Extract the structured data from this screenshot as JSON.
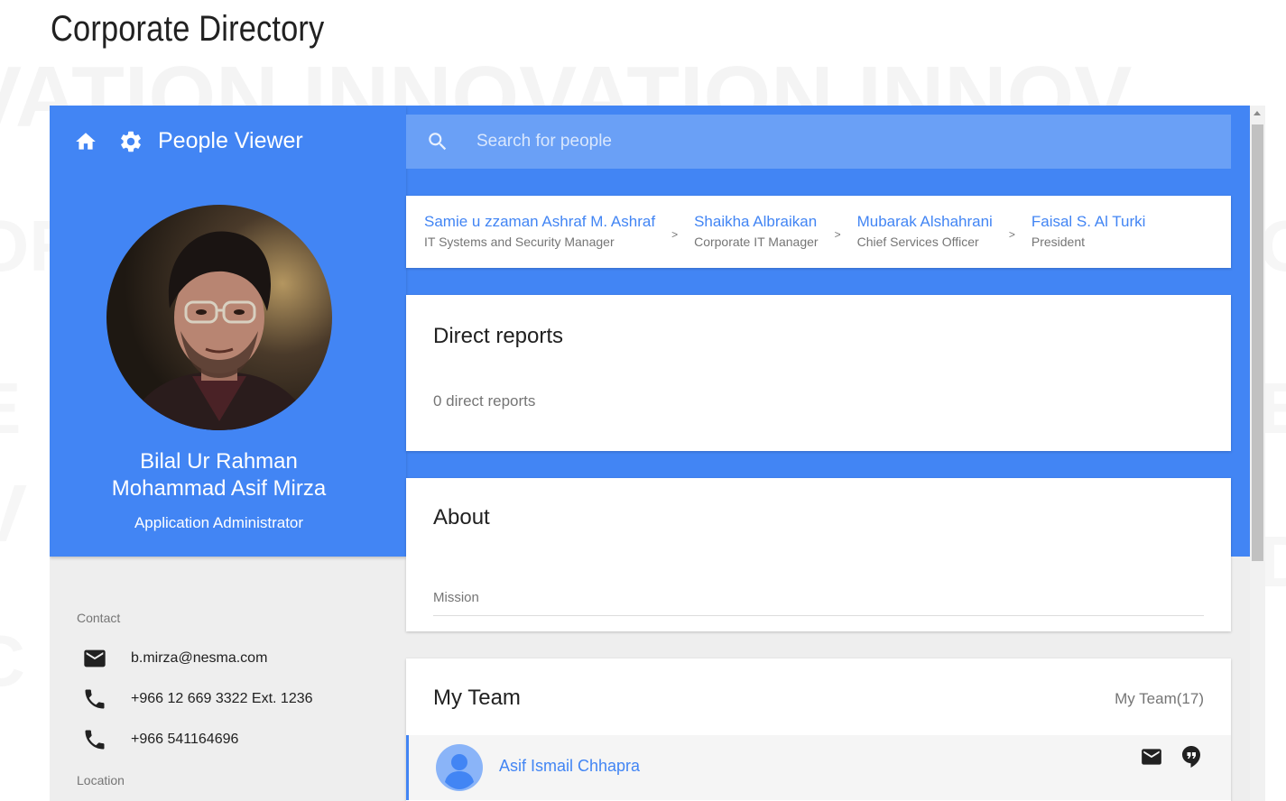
{
  "page": {
    "title": "Corporate Directory"
  },
  "app": {
    "name": "People Viewer",
    "icons": {
      "home": "home-icon",
      "settings": "gear-icon"
    },
    "accent": "#4285f4"
  },
  "search": {
    "placeholder": "Search for people",
    "value": ""
  },
  "profile": {
    "name_line1": "Bilal Ur Rahman",
    "name_line2": "Mohammad Asif Mirza",
    "title": "Application Administrator"
  },
  "contact": {
    "label": "Contact",
    "email": "b.mirza@nesma.com",
    "phone_office": "+966 12 669 3322 Ext. 1236",
    "phone_mobile": "+966 541164696"
  },
  "location": {
    "label": "Location"
  },
  "management_chain": [
    {
      "name": "Samie u zzaman Ashraf M. Ashraf",
      "title": "IT Systems and Security Manager"
    },
    {
      "name": "Shaikha Albraikan",
      "title": "Corporate IT Manager"
    },
    {
      "name": "Mubarak Alshahrani",
      "title": "Chief Services Officer"
    },
    {
      "name": "Faisal S. Al Turki",
      "title": "President"
    }
  ],
  "chain_separator": ">",
  "direct_reports": {
    "title": "Direct reports",
    "summary": "0 direct reports"
  },
  "about": {
    "title": "About",
    "mission_label": "Mission"
  },
  "team": {
    "title": "My Team",
    "count_label": "My Team(17)",
    "members": [
      {
        "name": "Asif Ismail Chhapra"
      }
    ]
  }
}
